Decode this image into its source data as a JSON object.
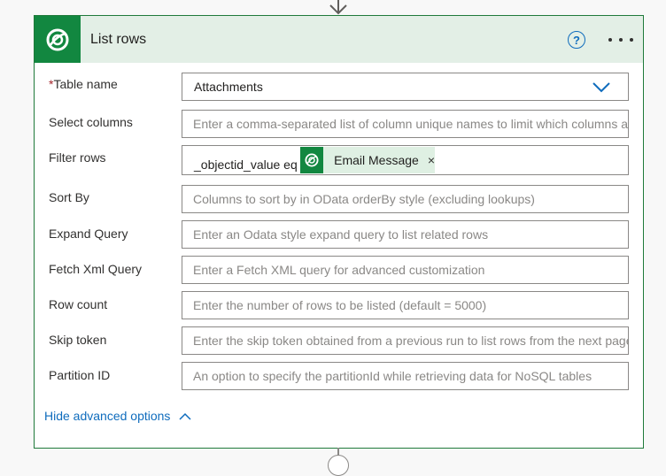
{
  "header": {
    "title": "List rows",
    "help_icon": "?",
    "icon": "dataverse-icon",
    "accent": "#128740"
  },
  "fields": {
    "table_name": {
      "label": "Table name",
      "required_mark": "*",
      "value": "Attachments"
    },
    "select_columns": {
      "label": "Select columns",
      "placeholder": "Enter a comma-separated list of column unique names to limit which columns are listed"
    },
    "filter_rows": {
      "label": "Filter rows",
      "value_prefix": "_objectid_value eq",
      "token_label": "Email Message",
      "token_close": "×"
    },
    "sort_by": {
      "label": "Sort By",
      "placeholder": "Columns to sort by in OData orderBy style (excluding lookups)"
    },
    "expand_query": {
      "label": "Expand Query",
      "placeholder": "Enter an Odata style expand query to list related rows"
    },
    "fetch_xml": {
      "label": "Fetch Xml Query",
      "placeholder": "Enter a Fetch XML query for advanced customization"
    },
    "row_count": {
      "label": "Row count",
      "placeholder": "Enter the number of rows to be listed (default = 5000)"
    },
    "skip_token": {
      "label": "Skip token",
      "placeholder": "Enter the skip token obtained from a previous run to list rows from the next page"
    },
    "partition_id": {
      "label": "Partition ID",
      "placeholder": "An option to specify the partitionId while retrieving data for NoSQL tables"
    }
  },
  "footer": {
    "hide_advanced_label": "Hide advanced options"
  }
}
